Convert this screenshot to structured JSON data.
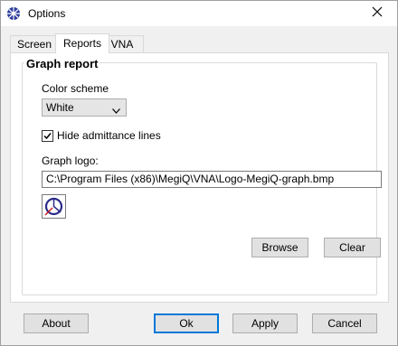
{
  "window": {
    "title": "Options"
  },
  "tabs": [
    {
      "label": "Screen"
    },
    {
      "label": "Reports"
    },
    {
      "label": "VNA"
    }
  ],
  "graph_report": {
    "title": "Graph report",
    "color_scheme_label": "Color scheme",
    "color_scheme_value": "White",
    "hide_admittance_label": "Hide admittance lines",
    "hide_admittance_checked": true,
    "graph_logo_label": "Graph logo:",
    "graph_logo_path": "C:\\Program Files (x86)\\MegiQ\\VNA\\Logo-MegiQ-graph.bmp",
    "browse_label": "Browse",
    "clear_label": "Clear"
  },
  "footer": {
    "about_label": "About",
    "ok_label": "Ok",
    "apply_label": "Apply",
    "cancel_label": "Cancel"
  },
  "icons": {
    "app": "globe-icon",
    "close": "close-icon",
    "dropdown": "chevron-down-icon",
    "check": "check-icon",
    "logo": "logo-preview-icon"
  },
  "colors": {
    "accent": "#0078d7",
    "app_icon": "#2a3a9c"
  }
}
